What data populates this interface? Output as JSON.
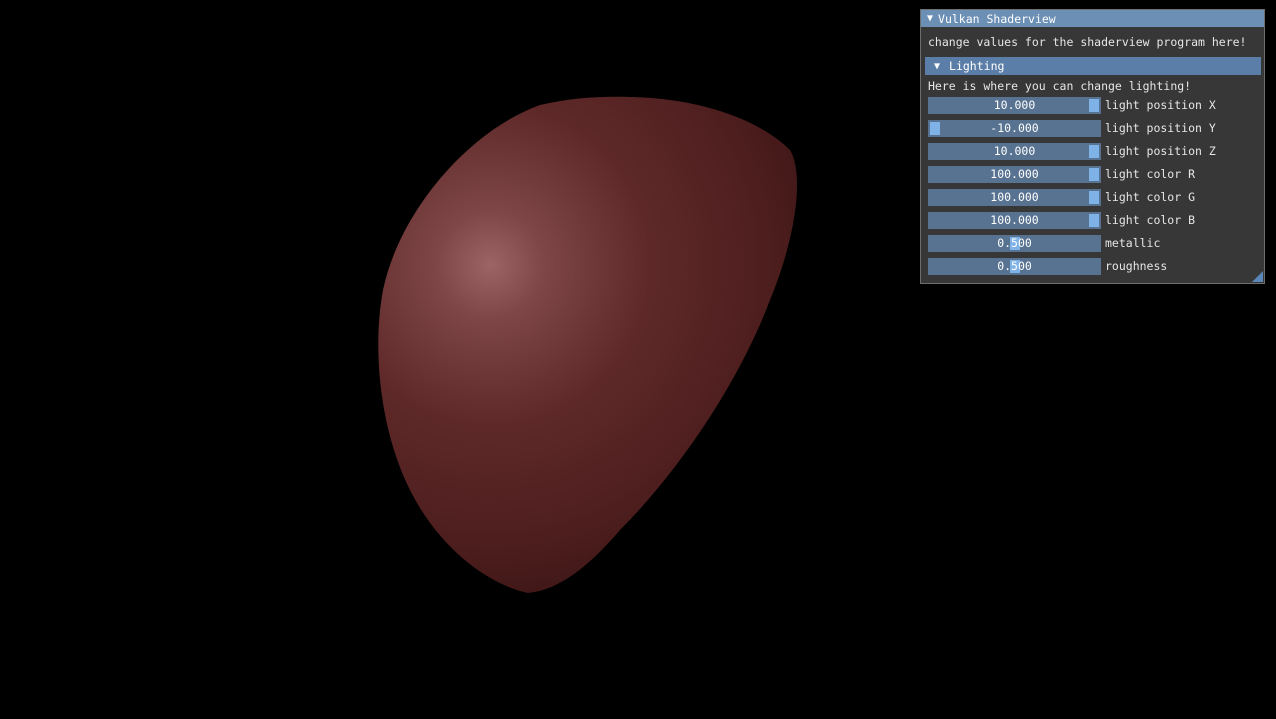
{
  "window": {
    "title": "Vulkan Shaderview",
    "title_arrow": "▼",
    "description": "change values for the shaderview program here!"
  },
  "lighting": {
    "header_label": "Lighting",
    "header_arrow": "▼",
    "description": "Here is where you can change lighting!",
    "sliders": [
      {
        "label": "light position X",
        "value": "10.000",
        "fraction": 1.0
      },
      {
        "label": "light position Y",
        "value": "-10.000",
        "fraction": 0.0
      },
      {
        "label": "light position Z",
        "value": "10.000",
        "fraction": 1.0
      },
      {
        "label": "light color R",
        "value": "100.000",
        "fraction": 1.0
      },
      {
        "label": "light color G",
        "value": "100.000",
        "fraction": 1.0
      },
      {
        "label": "light color B",
        "value": "100.000",
        "fraction": 1.0
      },
      {
        "label": "metallic",
        "value": "0.500",
        "fraction": 0.5
      },
      {
        "label": "roughness",
        "value": "0.500",
        "fraction": 0.5
      }
    ]
  },
  "colors": {
    "background": "#000000",
    "title_bar": "#6c8fb5",
    "header": "#5b7ea8",
    "slider_frame": "#587391",
    "slider_grab": "#7fb3e8",
    "sphere_base": "#6a2a2a"
  }
}
